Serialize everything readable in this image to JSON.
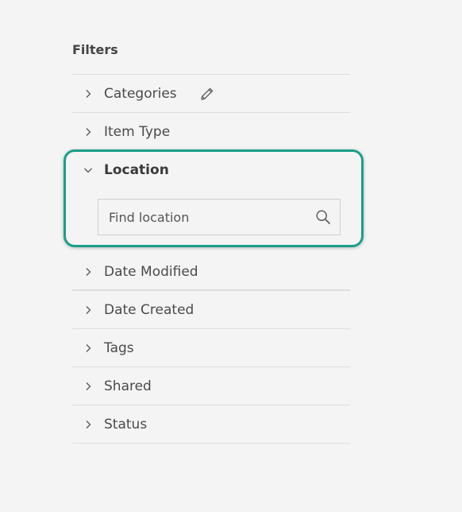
{
  "panel": {
    "title": "Filters"
  },
  "filters_top": [
    {
      "label": "Categories",
      "expanded": false,
      "editable": true
    },
    {
      "label": "Item Type",
      "expanded": false
    }
  ],
  "location": {
    "label": "Location",
    "expanded": true,
    "search": {
      "placeholder": "Find location",
      "value": ""
    }
  },
  "filters_bottom": [
    {
      "label": "Date Modified",
      "expanded": false
    },
    {
      "label": "Date Created",
      "expanded": false
    },
    {
      "label": "Tags",
      "expanded": false
    },
    {
      "label": "Shared",
      "expanded": false
    },
    {
      "label": "Status",
      "expanded": false
    }
  ],
  "colors": {
    "background": "#f4f4f4",
    "divider": "#dddddd",
    "highlight": "#1a9e8a",
    "text": "#4a4a4a"
  },
  "icons": {
    "collapsed": "chevron-right-icon",
    "expanded": "chevron-down-icon",
    "edit": "pencil-icon",
    "search": "search-icon"
  }
}
